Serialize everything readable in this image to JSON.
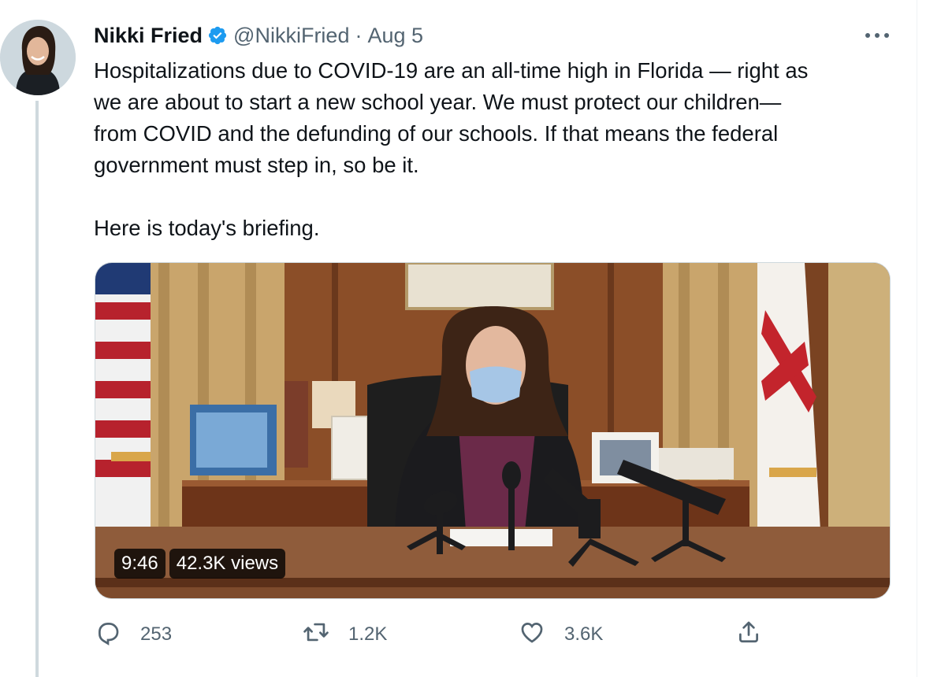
{
  "tweet": {
    "author_name": "Nikki Fried",
    "handle": "@NikkiFried",
    "separator": "·",
    "date": "Aug 5",
    "text": "Hospitalizations due to COVID-19 are an all-time high in Florida — right as\nwe are about to start a new school year. We must protect our children—\nfrom COVID and the defunding of our schools. If that means the federal\ngovernment must step in, so be it.\n\nHere is today's briefing."
  },
  "video": {
    "duration": "9:46",
    "views": "42.3K views"
  },
  "actions": {
    "reply_count": "253",
    "retweet_count": "1.2K",
    "like_count": "3.6K"
  },
  "icons": {
    "verified": "verified-badge-icon",
    "more": "more-dots-icon",
    "reply": "reply-icon",
    "retweet": "retweet-icon",
    "like": "heart-icon",
    "share": "share-icon"
  },
  "colors": {
    "verified_blue": "#1d9bf0",
    "secondary_text": "#536471",
    "primary_text": "#0f1419"
  }
}
